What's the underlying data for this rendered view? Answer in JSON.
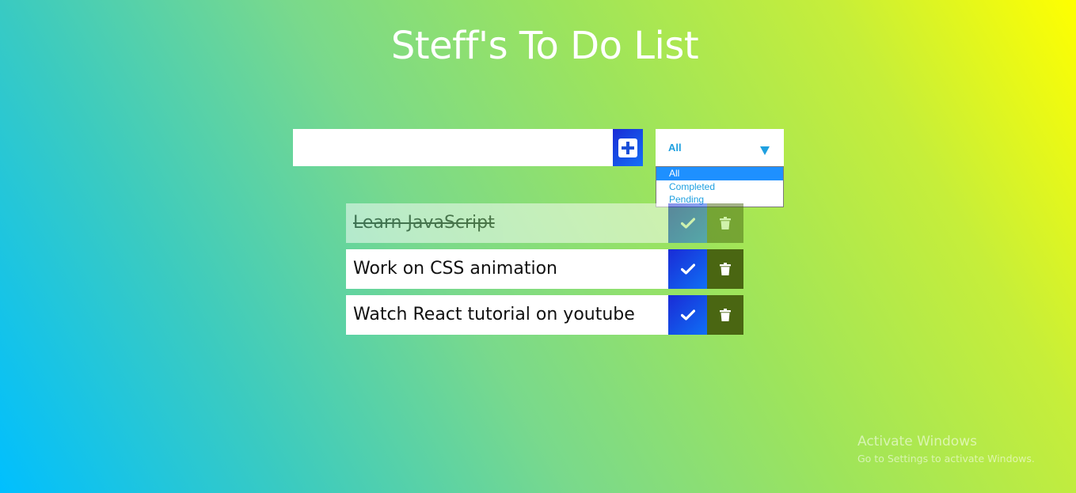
{
  "page": {
    "title": "Steff's To Do List"
  },
  "input": {
    "value": "",
    "add_icon": "plus-icon"
  },
  "filter": {
    "selected": "All",
    "options": [
      "All",
      "Completed",
      "Pending"
    ]
  },
  "todos": [
    {
      "text": "Learn JavaScript",
      "completed": true
    },
    {
      "text": "Work on CSS animation",
      "completed": false
    },
    {
      "text": "Watch React tutorial on youtube",
      "completed": false
    }
  ],
  "icons": {
    "check": "check-icon",
    "trash": "trash-icon"
  },
  "colors": {
    "accent_blue": "#1a2bd6",
    "trash_green": "#4a6612",
    "filter_text": "#1fa0e0"
  },
  "watermark": {
    "title": "Activate Windows",
    "subtitle": "Go to Settings to activate Windows."
  }
}
